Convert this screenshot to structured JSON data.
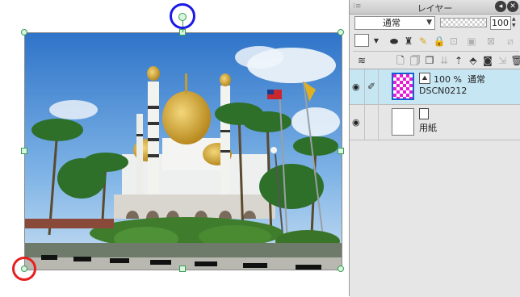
{
  "panel": {
    "title": "レイヤー",
    "grip_icon": "drag-grip-icon",
    "blend_mode": "通常",
    "opacity_value": "100"
  },
  "layers": [
    {
      "opacity": "100 %",
      "blend": "通常",
      "name": "DSCN0212",
      "visible": true,
      "selected": true
    },
    {
      "name": "用紙",
      "visible": true,
      "selected": false
    }
  ],
  "colors": {
    "handle": "#3a9c55",
    "rotate_highlight": "#1a1ae6",
    "anchor_highlight": "#e62020",
    "selected_layer": "#c7e6f4"
  }
}
